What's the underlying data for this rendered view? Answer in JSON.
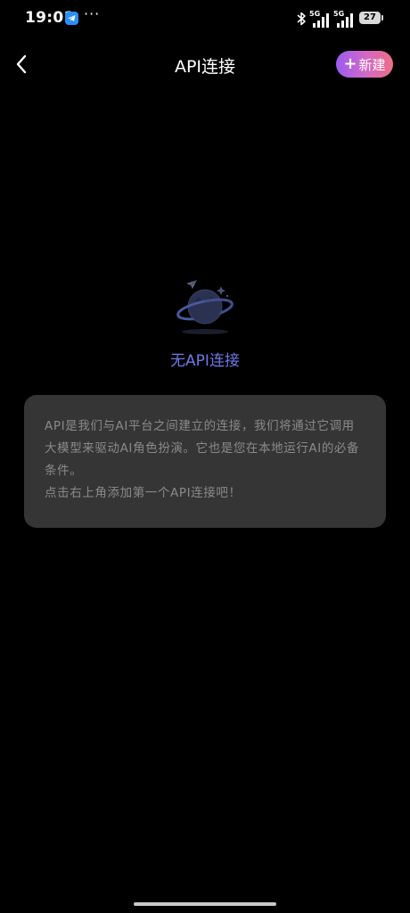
{
  "status_bar": {
    "time": "19:01",
    "more": "···",
    "signal_1_label": "5G",
    "signal_2_label": "5G",
    "battery_level": "27"
  },
  "header": {
    "title": "API连接",
    "new_button_plus": "+",
    "new_button_label": "新建"
  },
  "empty_state": {
    "title": "无API连接"
  },
  "info_card": {
    "paragraph_1": "API是我们与AI平台之间建立的连接，我们将通过它调用大模型来驱动AI角色扮演。它也是您在本地运行AI的必备条件。",
    "paragraph_2": "点击右上角添加第一个API连接吧！"
  },
  "colors": {
    "background": "#000000",
    "accent_text": "#6f78e6",
    "card_bg": "#353535",
    "card_text": "#8a8a8a",
    "button_gradient_start": "#9b5cf0",
    "button_gradient_end": "#ee6e86"
  },
  "icons": {
    "back": "chevron-left-icon",
    "illustration": "planet-icon",
    "bluetooth": "bluetooth-icon",
    "app_notification": "telegram-icon"
  }
}
